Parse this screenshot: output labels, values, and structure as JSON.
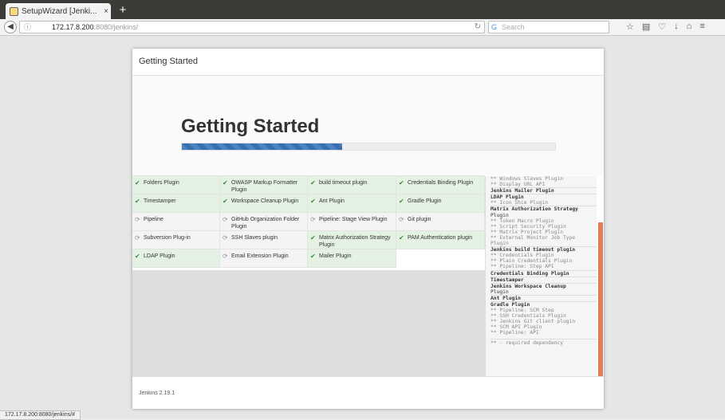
{
  "browser": {
    "tab_title": "SetupWizard [Jenki...",
    "tab_close": "×",
    "new_tab": "+",
    "url_host": "172.17.8.200",
    "url_rest": ":8080/jenkins/",
    "search_placeholder": "Search",
    "status_url": "172.17.8.200:8080/jenkins/#"
  },
  "wizard": {
    "header_title": "Getting Started",
    "hero_title": "Getting Started",
    "progress_fraction": 0.43,
    "footer_version": "Jenkins 2.19.1"
  },
  "plugins": [
    {
      "label": "Folders Plugin",
      "status": "done"
    },
    {
      "label": "OWASP Markup Formatter Plugin",
      "status": "done"
    },
    {
      "label": "build timeout plugin",
      "status": "done"
    },
    {
      "label": "Credentials Binding Plugin",
      "status": "done"
    },
    {
      "label": "Timestamper",
      "status": "done"
    },
    {
      "label": "Workspace Cleanup Plugin",
      "status": "done"
    },
    {
      "label": "Ant Plugin",
      "status": "done"
    },
    {
      "label": "Gradle Plugin",
      "status": "done"
    },
    {
      "label": "Pipeline",
      "status": "pending"
    },
    {
      "label": "GitHub Organization Folder Plugin",
      "status": "pending"
    },
    {
      "label": "Pipeline: Stage View Plugin",
      "status": "pending"
    },
    {
      "label": "Git plugin",
      "status": "pending"
    },
    {
      "label": "Subversion Plug-in",
      "status": "pending"
    },
    {
      "label": "SSH Slaves plugin",
      "status": "pending"
    },
    {
      "label": "Matrix Authorization Strategy Plugin",
      "status": "done"
    },
    {
      "label": "PAM Authentication plugin",
      "status": "done"
    },
    {
      "label": "LDAP Plugin",
      "status": "done"
    },
    {
      "label": "Email Extension Plugin",
      "status": "pending"
    },
    {
      "label": "Mailer Plugin",
      "status": "done"
    }
  ],
  "log": [
    {
      "text": "** Windows Slaves Plugin",
      "type": "dep"
    },
    {
      "text": "** Display URL API",
      "type": "dep"
    },
    {
      "text": "Jenkins Mailer Plugin",
      "type": "name"
    },
    {
      "text": "LDAP Plugin",
      "type": "name"
    },
    {
      "text": "** Icon Shim Plugin",
      "type": "dep"
    },
    {
      "text": "Matrix Authorization Strategy",
      "type": "name"
    },
    {
      "text": "Plugin",
      "type": "name-cont"
    },
    {
      "text": "** Token Macro Plugin",
      "type": "dep"
    },
    {
      "text": "** Script Security Plugin",
      "type": "dep"
    },
    {
      "text": "** Matrix Project Plugin",
      "type": "dep"
    },
    {
      "text": "** External Monitor Job Type",
      "type": "dep"
    },
    {
      "text": "Plugin",
      "type": "dep"
    },
    {
      "text": "Jenkins build timeout plugin",
      "type": "name"
    },
    {
      "text": "** Credentials Plugin",
      "type": "dep"
    },
    {
      "text": "** Plain Credentials Plugin",
      "type": "dep"
    },
    {
      "text": "** Pipeline: Step API",
      "type": "dep"
    },
    {
      "text": "Credentials Binding Plugin",
      "type": "name"
    },
    {
      "text": "Timestamper",
      "type": "name"
    },
    {
      "text": "Jenkins Workspace Cleanup",
      "type": "name"
    },
    {
      "text": "Plugin",
      "type": "name-cont"
    },
    {
      "text": "Ant Plugin",
      "type": "name"
    },
    {
      "text": "Gradle Plugin",
      "type": "name"
    },
    {
      "text": "** Pipeline: SCM Step",
      "type": "dep"
    },
    {
      "text": "** SSH Credentials Plugin",
      "type": "dep"
    },
    {
      "text": "** Jenkins Git client plugin",
      "type": "dep"
    },
    {
      "text": "** SCM API Plugin",
      "type": "dep"
    },
    {
      "text": "** Pipeline: API",
      "type": "dep"
    }
  ],
  "log_legend": "** - required dependency",
  "icons": {
    "done": "✔",
    "pending": "⟳"
  }
}
